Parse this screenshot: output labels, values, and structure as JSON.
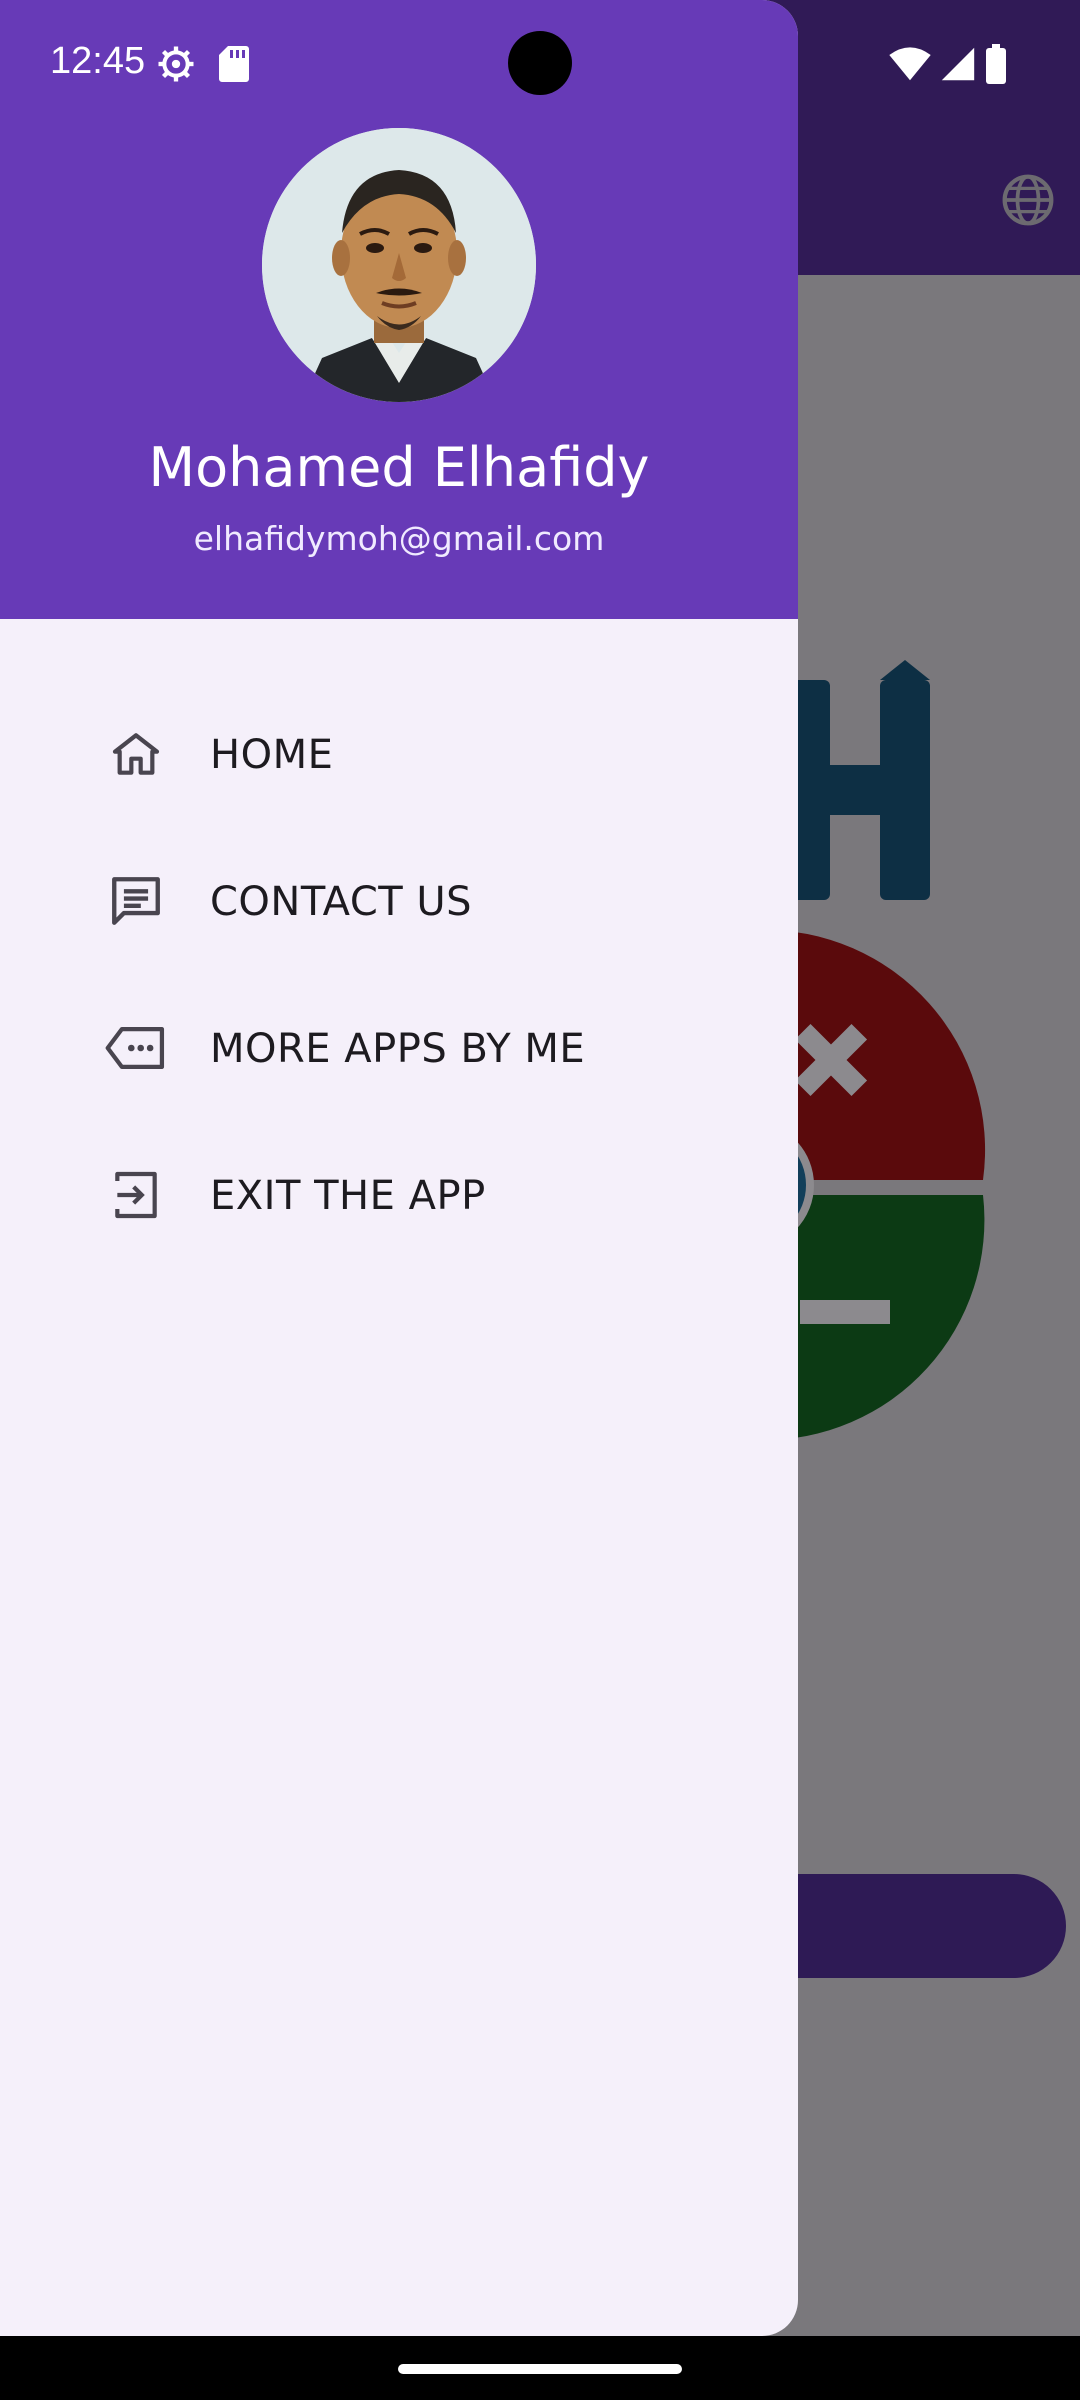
{
  "status_bar": {
    "time": "12:45",
    "icons": [
      "settings-icon",
      "sd-card-icon",
      "wifi-icon",
      "signal-icon",
      "battery-icon"
    ]
  },
  "drawer": {
    "header": {
      "name": "Mohamed Elhafidy",
      "email": "elhafidymoh@gmail.com",
      "avatar_icon": "profile-photo"
    },
    "menu": [
      {
        "label": "HOME",
        "icon": "home-icon"
      },
      {
        "label": "CONTACT US",
        "icon": "message-icon"
      },
      {
        "label": "MORE APPS BY ME",
        "icon": "more-apps-icon"
      },
      {
        "label": "EXIT THE APP",
        "icon": "exit-icon"
      }
    ]
  },
  "colors": {
    "header": "#673ab7",
    "drawer_bg": "#f5f0fa",
    "scrim_bg": "#7a787c",
    "bg_appbar": "#301a56"
  }
}
